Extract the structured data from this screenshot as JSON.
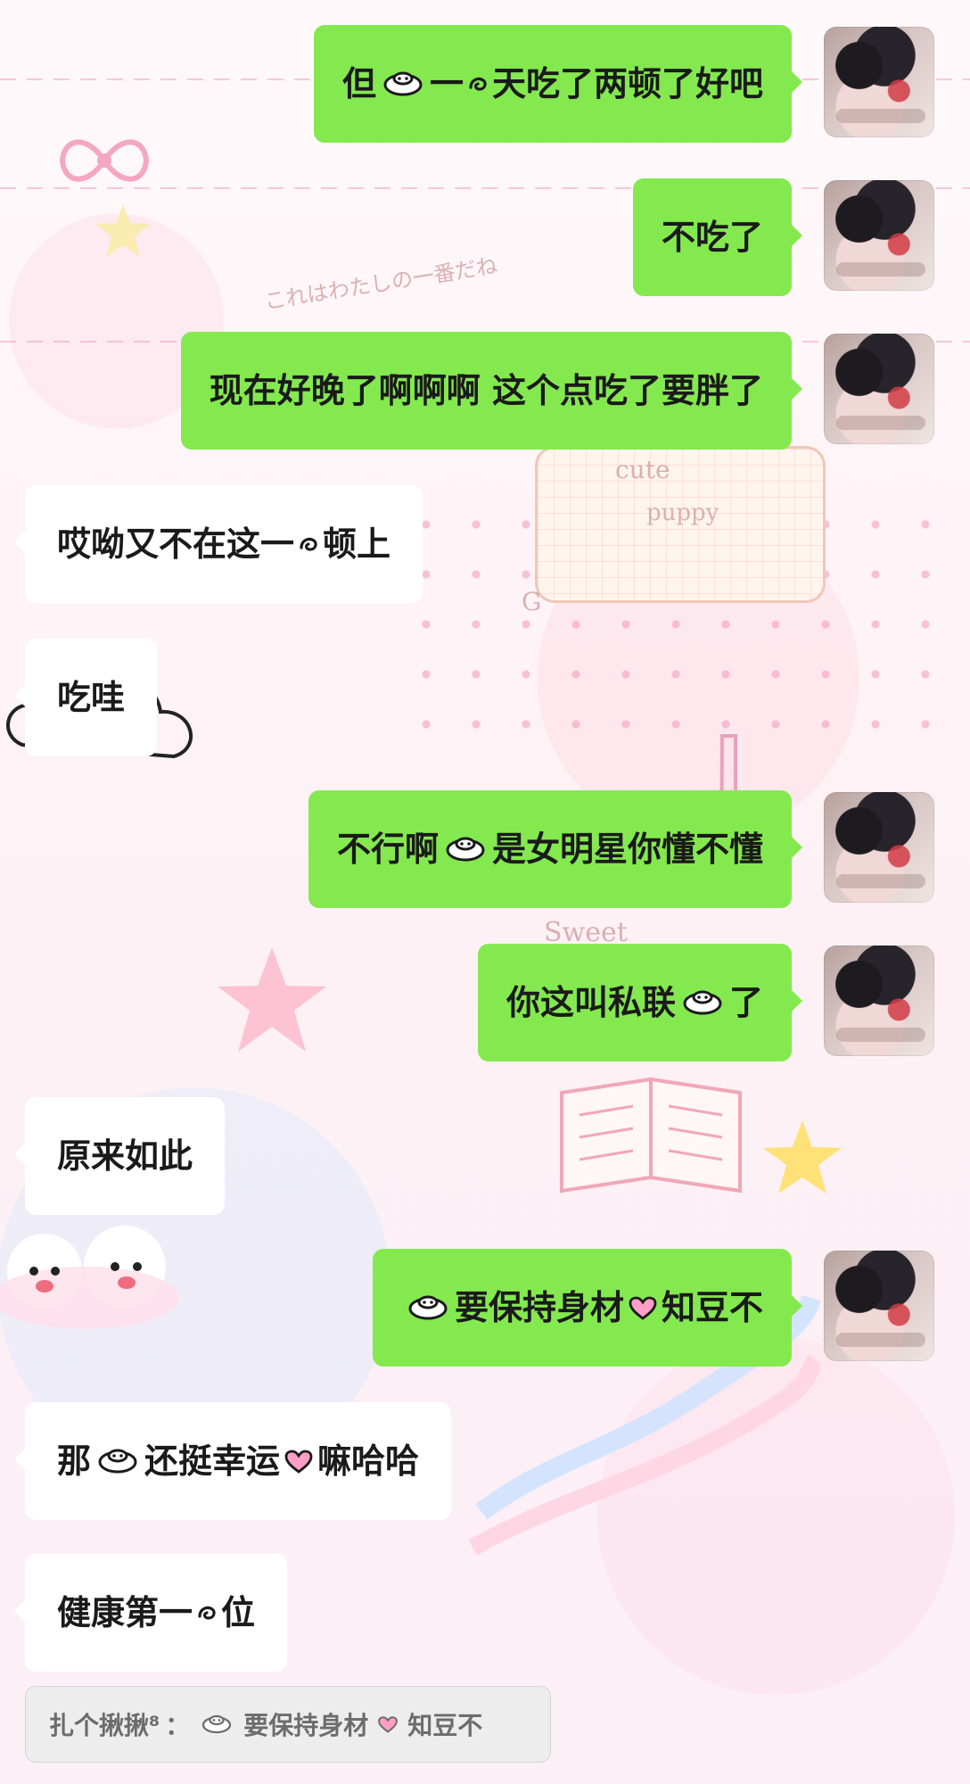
{
  "messages": [
    {
      "id": "m1",
      "direction": "outgoing",
      "parts": [
        "但",
        "icon:smile-face",
        "一",
        "icon:swirl-small",
        "天吃了两顿了好吧"
      ]
    },
    {
      "id": "m2",
      "direction": "outgoing",
      "parts": [
        "不吃了"
      ]
    },
    {
      "id": "m3",
      "direction": "outgoing",
      "parts": [
        "现在好晚了啊啊啊  这个点吃了要胖了"
      ]
    },
    {
      "id": "m4",
      "direction": "incoming",
      "parts": [
        "哎呦又不在这一",
        "icon:swirl-small",
        "顿上"
      ]
    },
    {
      "id": "m5",
      "direction": "incoming",
      "parts": [
        "吃哇"
      ]
    },
    {
      "id": "m6",
      "direction": "outgoing",
      "parts": [
        "不行啊",
        "icon:smile-face",
        "是女明星你懂不懂"
      ]
    },
    {
      "id": "m7",
      "direction": "outgoing",
      "parts": [
        "你这叫私联",
        "icon:smile-face",
        "了"
      ]
    },
    {
      "id": "m8",
      "direction": "incoming",
      "parts": [
        "原来如此"
      ]
    },
    {
      "id": "m9",
      "direction": "outgoing",
      "parts": [
        "icon:smile-face",
        "要保持身材",
        "icon:heart-pink",
        "知豆不"
      ]
    },
    {
      "id": "m10",
      "direction": "incoming",
      "parts": [
        "那",
        "icon:smile-face",
        "还挺幸运",
        "icon:heart-pink",
        "嘛哈哈"
      ]
    },
    {
      "id": "m11",
      "direction": "incoming",
      "parts": [
        "健康第一",
        "icon:swirl-small",
        "位"
      ]
    }
  ],
  "quoted_reply": {
    "sender": "扎个揪揪⁸",
    "separator": "：",
    "parts": [
      "icon:smile-face",
      "要保持身材",
      "icon:heart-pink",
      "知豆不"
    ]
  },
  "wallpaper": {
    "labels": [
      "cute",
      "puppy",
      "G",
      "Sweet",
      "これはわたしの一番だね"
    ]
  },
  "colors": {
    "outgoing_bubble": "#84e94f",
    "incoming_bubble": "#ffffff",
    "quote_box": "#ececec",
    "text": "#1a1a1a"
  }
}
